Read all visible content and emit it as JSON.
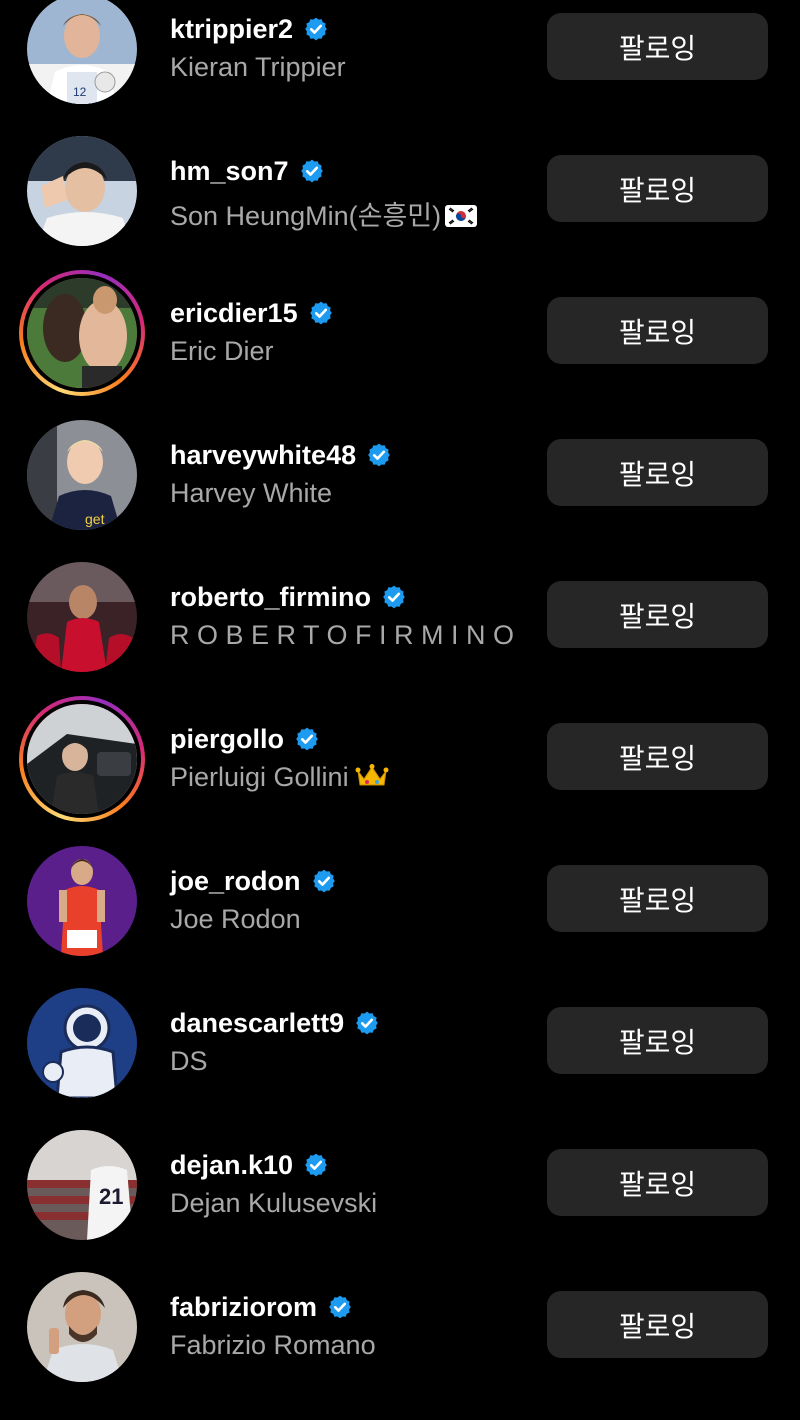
{
  "following_list": {
    "follow_button_label": "팔로잉",
    "accent_verified_color": "#1d9bf0",
    "rows": [
      {
        "username": "ktrippier2",
        "full_name": "Kieran Trippier",
        "verified": true,
        "story_ring": false,
        "avatar_icon": "avatar-ktrippier2"
      },
      {
        "username": "hm_son7",
        "full_name": "Son HeungMin(손흥민)",
        "name_emoji": "south-korea-flag-icon",
        "verified": true,
        "story_ring": false,
        "avatar_icon": "avatar-hm-son7"
      },
      {
        "username": "ericdier15",
        "full_name": "Eric Dier",
        "verified": true,
        "story_ring": true,
        "avatar_icon": "avatar-ericdier15"
      },
      {
        "username": "harveywhite48",
        "full_name": "Harvey White",
        "verified": true,
        "story_ring": false,
        "avatar_icon": "avatar-harveywhite48"
      },
      {
        "username": "roberto_firmino",
        "full_name": "R O B E R T O F I R M I N O",
        "verified": true,
        "story_ring": false,
        "avatar_icon": "avatar-roberto-firmino"
      },
      {
        "username": "piergollo",
        "full_name": "Pierluigi Gollini",
        "name_emoji": "crown-icon",
        "verified": true,
        "story_ring": true,
        "avatar_icon": "avatar-piergollo"
      },
      {
        "username": "joe_rodon",
        "full_name": "Joe Rodon",
        "verified": true,
        "story_ring": false,
        "avatar_icon": "avatar-joe-rodon"
      },
      {
        "username": "danescarlett9",
        "full_name": "DS",
        "verified": true,
        "story_ring": false,
        "avatar_icon": "avatar-danescarlett9"
      },
      {
        "username": "dejan.k10",
        "full_name": "Dejan Kulusevski",
        "verified": true,
        "story_ring": false,
        "avatar_icon": "avatar-dejan-k10"
      },
      {
        "username": "fabriziorom",
        "full_name": "Fabrizio Romano",
        "verified": true,
        "story_ring": false,
        "avatar_icon": "avatar-fabriziorom"
      }
    ]
  }
}
